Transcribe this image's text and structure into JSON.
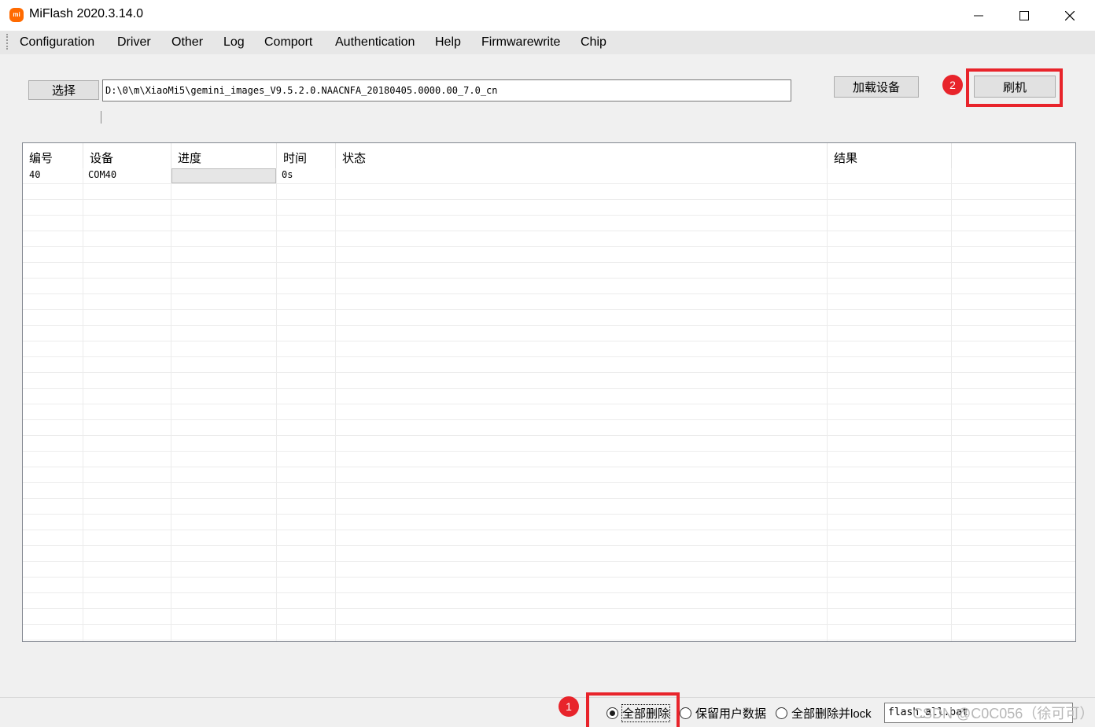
{
  "window": {
    "logo_text": "mi",
    "title": "MiFlash 2020.3.14.0"
  },
  "menu": [
    "Configuration",
    "Driver",
    "Other",
    "Log",
    "Comport",
    "Authentication",
    "Help",
    "Firmwarewrite",
    "Chip"
  ],
  "toolbar": {
    "select_label": "选择",
    "path_value": "D:\\0\\m\\XiaoMi5\\gemini_images_V9.5.2.0.NAACNFA_20180405.0000.00_7.0_cn",
    "load_devices_label": "加载设备",
    "flash_label": "刷机"
  },
  "table": {
    "columns": [
      "编号",
      "设备",
      "进度",
      "时间",
      "状态",
      "结果"
    ],
    "rows": [
      {
        "id": "40",
        "device": "COM40",
        "progress": 0,
        "time": "0s",
        "status": "",
        "result": ""
      }
    ]
  },
  "bottom": {
    "options": [
      "全部删除",
      "保留用户数据",
      "全部删除并lock"
    ],
    "selected_option": "全部删除",
    "script_value": "flash_all.bat"
  },
  "annotations": {
    "badge_1": "1",
    "badge_2": "2",
    "highlight_color": "#e8242b"
  },
  "watermark": "CSDN @C0C056（徐可可）"
}
